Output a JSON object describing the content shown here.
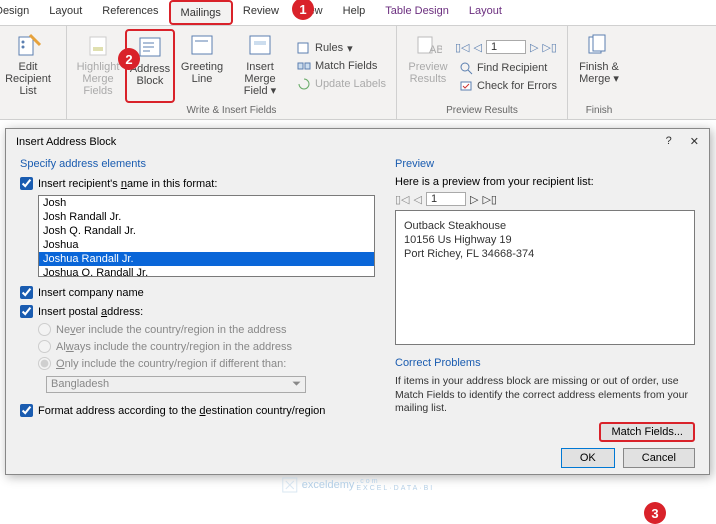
{
  "ribbon": {
    "tabs": [
      "Design",
      "Layout",
      "References",
      "Mailings",
      "Review",
      "View",
      "Help",
      "Table Design",
      "Layout"
    ],
    "groups": {
      "start": {
        "edit": "Edit\nRecipient List"
      },
      "write": {
        "label": "Write & Insert Fields",
        "highlight": "Highlight\nMerge Fields",
        "address": "Address\nBlock",
        "greeting": "Greeting\nLine",
        "insert": "Insert Merge\nField",
        "rules": "Rules",
        "match": "Match Fields",
        "update": "Update Labels"
      },
      "preview": {
        "label": "Preview Results",
        "btn": "Preview\nResults",
        "find": "Find Recipient",
        "check": "Check for Errors",
        "counter": "1"
      },
      "finish": {
        "label": "Finish",
        "btn": "Finish &\nMerge"
      }
    }
  },
  "dialog": {
    "title": "Insert Address Block",
    "left": {
      "header": "Specify address elements",
      "chk_name": "Insert recipient's name in this format:",
      "names": [
        "Josh",
        "Josh Randall Jr.",
        "Josh Q. Randall Jr.",
        "Joshua",
        "Joshua Randall Jr.",
        "Joshua Q. Randall Jr."
      ],
      "chk_company": "Insert company name",
      "chk_postal": "Insert postal address:",
      "r1": "Never include the country/region in the address",
      "r2": "Always include the country/region in the address",
      "r3": "Only include the country/region if different than:",
      "country": "Bangladesh",
      "chk_format": "Format address according to the destination country/region"
    },
    "right": {
      "preview_hdr": "Preview",
      "preview_sub": "Here is a preview from your recipient list:",
      "counter": "1",
      "addr": [
        "Outback Steakhouse",
        "10156 Us Highway 19",
        "Port Richey, FL 34668-374"
      ],
      "correct_hdr": "Correct Problems",
      "correct_txt": "If items in your address block are missing or out of order, use Match Fields to identify the correct address elements from your mailing list.",
      "match": "Match Fields...",
      "ok": "OK",
      "cancel": "Cancel"
    }
  },
  "watermark": "exceldemy"
}
